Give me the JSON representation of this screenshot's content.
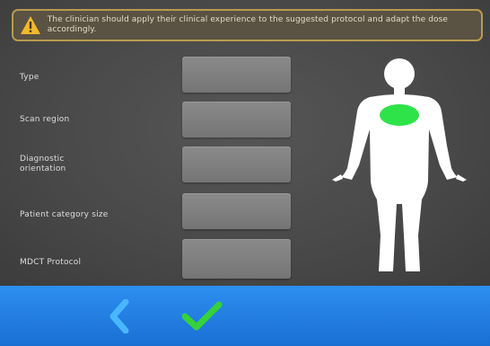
{
  "warning": {
    "text": "The clinician should apply their clinical experience to the suggested protocol and adapt the dose accordingly."
  },
  "form": {
    "rows": [
      {
        "label": "Type",
        "value": ""
      },
      {
        "label": "Scan region",
        "value": ""
      },
      {
        "label": "Diagnostic orientation",
        "value": ""
      },
      {
        "label": "Patient category size",
        "value": ""
      },
      {
        "label": "MDCT Protocol",
        "value": ""
      }
    ]
  },
  "body_map": {
    "highlighted_region": "chest",
    "highlight_color": "#2ee34a",
    "figure_color": "#ffffff"
  },
  "footer": {
    "back_icon": "chevron-left-icon",
    "confirm_icon": "checkmark-icon",
    "bar_color": "#1f7ee0",
    "back_color": "#49b7ff",
    "confirm_color": "#35d23a"
  },
  "colors": {
    "warning_border": "#b89b4f",
    "warning_icon": "#f2b92b"
  }
}
